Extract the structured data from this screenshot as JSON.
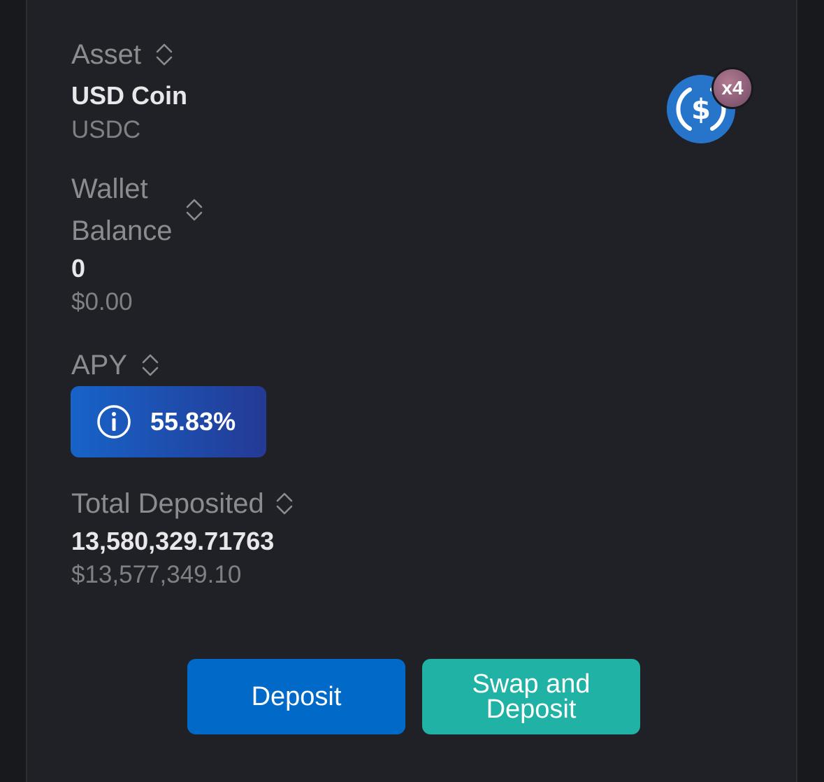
{
  "asset": {
    "label": "Asset",
    "name": "USD Coin",
    "symbol": "USDC",
    "multiplier": "x4",
    "icon": "usdc-coin-icon"
  },
  "wallet_balance": {
    "label_line1": "Wallet",
    "label_line2": "Balance",
    "amount": "0",
    "usd_value": "$0.00"
  },
  "apy": {
    "label": "APY",
    "value": "55.83%",
    "icon": "info-icon"
  },
  "total_deposited": {
    "label": "Total Deposited",
    "amount": "13,580,329.71763",
    "usd_value": "$13,577,349.10"
  },
  "actions": {
    "deposit_label": "Deposit",
    "swap_deposit_label": "Swap and Deposit"
  },
  "colors": {
    "background": "#17191d",
    "card": "#202126",
    "deposit_button": "#0169c8",
    "swap_button": "#20b2a5",
    "apy_gradient_start": "#1763c8",
    "apy_gradient_end": "#243a95",
    "usdc_blue": "#2775ca"
  }
}
